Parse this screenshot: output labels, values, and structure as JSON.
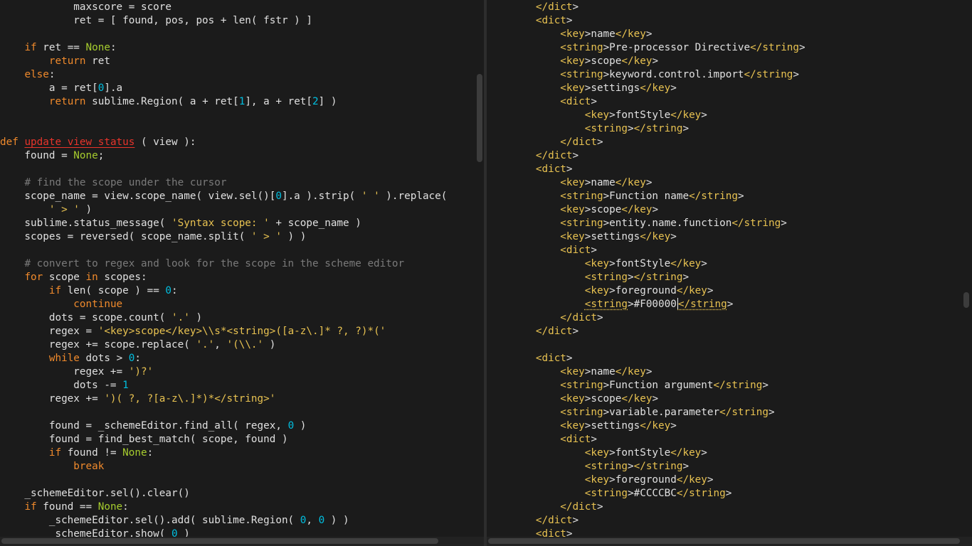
{
  "left_editor": {
    "language": "python",
    "lines": [
      [
        [
          "p",
          "            maxscore = score"
        ]
      ],
      [
        [
          "p",
          "            ret = [ found, pos, pos + "
        ],
        [
          "p",
          "len"
        ],
        [
          "p",
          "( fstr ) ]"
        ]
      ],
      [
        [
          "p",
          ""
        ]
      ],
      [
        [
          "p",
          "    "
        ],
        [
          "kw",
          "if"
        ],
        [
          "p",
          " ret == "
        ],
        [
          "const",
          "None"
        ],
        [
          "p",
          ":"
        ]
      ],
      [
        [
          "p",
          "        "
        ],
        [
          "kw",
          "return"
        ],
        [
          "p",
          " ret"
        ]
      ],
      [
        [
          "p",
          "    "
        ],
        [
          "kw",
          "else"
        ],
        [
          "p",
          ":"
        ]
      ],
      [
        [
          "p",
          "        a = ret["
        ],
        [
          "num",
          "0"
        ],
        [
          "p",
          "].a"
        ]
      ],
      [
        [
          "p",
          "        "
        ],
        [
          "kw",
          "return"
        ],
        [
          "p",
          " sublime.Region( a + ret["
        ],
        [
          "num",
          "1"
        ],
        [
          "p",
          "], a + ret["
        ],
        [
          "num",
          "2"
        ],
        [
          "p",
          "] )"
        ]
      ],
      [
        [
          "p",
          ""
        ]
      ],
      [
        [
          "p",
          ""
        ]
      ],
      [
        [
          "kw",
          "def"
        ],
        [
          "p",
          " "
        ],
        [
          "fn",
          "update_view_status"
        ],
        [
          "p",
          " ( view ):"
        ]
      ],
      [
        [
          "p",
          "    found = "
        ],
        [
          "const",
          "None"
        ],
        [
          "p",
          ";"
        ]
      ],
      [
        [
          "p",
          ""
        ]
      ],
      [
        [
          "p",
          "    "
        ],
        [
          "com",
          "# find the scope under the cursor"
        ]
      ],
      [
        [
          "p",
          "    scope_name = view.scope_name( view.sel()["
        ],
        [
          "num",
          "0"
        ],
        [
          "p",
          "].a ).strip( "
        ],
        [
          "str",
          "' '"
        ],
        [
          "p",
          " ).replace("
        ]
      ],
      [
        [
          "p",
          "        "
        ],
        [
          "str",
          "' > '"
        ],
        [
          "p",
          " )"
        ]
      ],
      [
        [
          "p",
          "    sublime.status_message( "
        ],
        [
          "str",
          "'Syntax scope: '"
        ],
        [
          "p",
          " + scope_name )"
        ]
      ],
      [
        [
          "p",
          "    scopes = reversed( scope_name.split( "
        ],
        [
          "str",
          "' > '"
        ],
        [
          "p",
          " ) )"
        ]
      ],
      [
        [
          "p",
          ""
        ]
      ],
      [
        [
          "p",
          "    "
        ],
        [
          "com",
          "# convert to regex and look for the scope in the scheme editor"
        ]
      ],
      [
        [
          "p",
          "    "
        ],
        [
          "kw",
          "for"
        ],
        [
          "p",
          " scope "
        ],
        [
          "kw",
          "in"
        ],
        [
          "p",
          " scopes:"
        ]
      ],
      [
        [
          "p",
          "        "
        ],
        [
          "kw",
          "if"
        ],
        [
          "p",
          " len( scope ) == "
        ],
        [
          "num",
          "0"
        ],
        [
          "p",
          ":"
        ]
      ],
      [
        [
          "p",
          "            "
        ],
        [
          "kw",
          "continue"
        ]
      ],
      [
        [
          "p",
          "        dots = scope.count( "
        ],
        [
          "str",
          "'.'"
        ],
        [
          "p",
          " )"
        ]
      ],
      [
        [
          "p",
          "        regex = "
        ],
        [
          "str",
          "'<key>scope</key>\\\\s*<string>([a-z\\.]* ?, ?)*('"
        ]
      ],
      [
        [
          "p",
          "        regex += scope.replace( "
        ],
        [
          "str",
          "'.'"
        ],
        [
          "p",
          ", "
        ],
        [
          "str",
          "'(\\\\.'"
        ],
        [
          "p",
          " )"
        ]
      ],
      [
        [
          "p",
          "        "
        ],
        [
          "kw",
          "while"
        ],
        [
          "p",
          " dots > "
        ],
        [
          "num",
          "0"
        ],
        [
          "p",
          ":"
        ]
      ],
      [
        [
          "p",
          "            regex += "
        ],
        [
          "str",
          "')?'"
        ]
      ],
      [
        [
          "p",
          "            dots -= "
        ],
        [
          "num",
          "1"
        ]
      ],
      [
        [
          "p",
          "        regex += "
        ],
        [
          "str",
          "')( ?, ?[a-z\\.]*)*</string>'"
        ]
      ],
      [
        [
          "p",
          ""
        ]
      ],
      [
        [
          "p",
          "        found = _schemeEditor.find_all( regex, "
        ],
        [
          "num",
          "0"
        ],
        [
          "p",
          " )"
        ]
      ],
      [
        [
          "p",
          "        found = find_best_match( scope, found )"
        ]
      ],
      [
        [
          "p",
          "        "
        ],
        [
          "kw",
          "if"
        ],
        [
          "p",
          " found != "
        ],
        [
          "const",
          "None"
        ],
        [
          "p",
          ":"
        ]
      ],
      [
        [
          "p",
          "            "
        ],
        [
          "kw",
          "break"
        ]
      ],
      [
        [
          "p",
          ""
        ]
      ],
      [
        [
          "p",
          "    _schemeEditor.sel().clear()"
        ]
      ],
      [
        [
          "p",
          "    "
        ],
        [
          "kw",
          "if"
        ],
        [
          "p",
          " found == "
        ],
        [
          "const",
          "None"
        ],
        [
          "p",
          ":"
        ]
      ],
      [
        [
          "p",
          "        _schemeEditor.sel().add( sublime.Region( "
        ],
        [
          "num",
          "0"
        ],
        [
          "p",
          ", "
        ],
        [
          "num",
          "0"
        ],
        [
          "p",
          " ) )"
        ]
      ],
      [
        [
          "p",
          "        _schemeEditor.show( "
        ],
        [
          "num",
          "0"
        ],
        [
          "p",
          " )"
        ]
      ]
    ]
  },
  "right_editor": {
    "language": "xml",
    "lines": [
      [
        [
          "p",
          "        "
        ],
        [
          "tag",
          "</dict"
        ],
        [
          "p",
          ">"
        ]
      ],
      [
        [
          "p",
          "        "
        ],
        [
          "tag",
          "<dict"
        ],
        [
          "p",
          ">"
        ]
      ],
      [
        [
          "p",
          "            "
        ],
        [
          "tag",
          "<key"
        ],
        [
          "p",
          ">name"
        ],
        [
          "tag",
          "</key"
        ],
        [
          "p",
          ">"
        ]
      ],
      [
        [
          "p",
          "            "
        ],
        [
          "tag",
          "<string"
        ],
        [
          "p",
          ">Pre-processor Directive"
        ],
        [
          "tag",
          "</string"
        ],
        [
          "p",
          ">"
        ]
      ],
      [
        [
          "p",
          "            "
        ],
        [
          "tag",
          "<key"
        ],
        [
          "p",
          ">scope"
        ],
        [
          "tag",
          "</key"
        ],
        [
          "p",
          ">"
        ]
      ],
      [
        [
          "p",
          "            "
        ],
        [
          "tag",
          "<string"
        ],
        [
          "p",
          ">keyword.control.import"
        ],
        [
          "tag",
          "</string"
        ],
        [
          "p",
          ">"
        ]
      ],
      [
        [
          "p",
          "            "
        ],
        [
          "tag",
          "<key"
        ],
        [
          "p",
          ">settings"
        ],
        [
          "tag",
          "</key"
        ],
        [
          "p",
          ">"
        ]
      ],
      [
        [
          "p",
          "            "
        ],
        [
          "tag",
          "<dict"
        ],
        [
          "p",
          ">"
        ]
      ],
      [
        [
          "p",
          "                "
        ],
        [
          "tag",
          "<key"
        ],
        [
          "p",
          ">fontStyle"
        ],
        [
          "tag",
          "</key"
        ],
        [
          "p",
          ">"
        ]
      ],
      [
        [
          "p",
          "                "
        ],
        [
          "tag",
          "<string"
        ],
        [
          "p",
          ">"
        ],
        [
          "tag",
          "</string"
        ],
        [
          "p",
          ">"
        ]
      ],
      [
        [
          "p",
          "            "
        ],
        [
          "tag",
          "</dict"
        ],
        [
          "p",
          ">"
        ]
      ],
      [
        [
          "p",
          "        "
        ],
        [
          "tag",
          "</dict"
        ],
        [
          "p",
          ">"
        ]
      ],
      [
        [
          "p",
          "        "
        ],
        [
          "tag",
          "<dict"
        ],
        [
          "p",
          ">"
        ]
      ],
      [
        [
          "p",
          "            "
        ],
        [
          "tag",
          "<key"
        ],
        [
          "p",
          ">name"
        ],
        [
          "tag",
          "</key"
        ],
        [
          "p",
          ">"
        ]
      ],
      [
        [
          "p",
          "            "
        ],
        [
          "tag",
          "<string"
        ],
        [
          "p",
          ">Function name"
        ],
        [
          "tag",
          "</string"
        ],
        [
          "p",
          ">"
        ]
      ],
      [
        [
          "p",
          "            "
        ],
        [
          "tag",
          "<key"
        ],
        [
          "p",
          ">scope"
        ],
        [
          "tag",
          "</key"
        ],
        [
          "p",
          ">"
        ]
      ],
      [
        [
          "p",
          "            "
        ],
        [
          "tag",
          "<string"
        ],
        [
          "p",
          ">entity.name.function"
        ],
        [
          "tag",
          "</string"
        ],
        [
          "p",
          ">"
        ]
      ],
      [
        [
          "p",
          "            "
        ],
        [
          "tag",
          "<key"
        ],
        [
          "p",
          ">settings"
        ],
        [
          "tag",
          "</key"
        ],
        [
          "p",
          ">"
        ]
      ],
      [
        [
          "p",
          "            "
        ],
        [
          "tag",
          "<dict"
        ],
        [
          "p",
          ">"
        ]
      ],
      [
        [
          "p",
          "                "
        ],
        [
          "tag",
          "<key"
        ],
        [
          "p",
          ">fontStyle"
        ],
        [
          "tag",
          "</key"
        ],
        [
          "p",
          ">"
        ]
      ],
      [
        [
          "p",
          "                "
        ],
        [
          "tag",
          "<string"
        ],
        [
          "p",
          ">"
        ],
        [
          "tag",
          "</string"
        ],
        [
          "p",
          ">"
        ]
      ],
      [
        [
          "p",
          "                "
        ],
        [
          "tag",
          "<key"
        ],
        [
          "p",
          ">foreground"
        ],
        [
          "tag",
          "</key"
        ],
        [
          "p",
          ">"
        ]
      ],
      [
        [
          "p",
          "                "
        ],
        [
          "tagu",
          "<string"
        ],
        [
          "p",
          ">#F00000"
        ],
        [
          "caret",
          ""
        ],
        [
          "tagu",
          "</string"
        ],
        [
          "p",
          ">"
        ]
      ],
      [
        [
          "p",
          "            "
        ],
        [
          "tag",
          "</dict"
        ],
        [
          "p",
          ">"
        ]
      ],
      [
        [
          "p",
          "        "
        ],
        [
          "tag",
          "</dict"
        ],
        [
          "p",
          ">"
        ]
      ],
      [
        [
          "p",
          ""
        ]
      ],
      [
        [
          "p",
          "        "
        ],
        [
          "tag",
          "<dict"
        ],
        [
          "p",
          ">"
        ]
      ],
      [
        [
          "p",
          "            "
        ],
        [
          "tag",
          "<key"
        ],
        [
          "p",
          ">name"
        ],
        [
          "tag",
          "</key"
        ],
        [
          "p",
          ">"
        ]
      ],
      [
        [
          "p",
          "            "
        ],
        [
          "tag",
          "<string"
        ],
        [
          "p",
          ">Function argument"
        ],
        [
          "tag",
          "</string"
        ],
        [
          "p",
          ">"
        ]
      ],
      [
        [
          "p",
          "            "
        ],
        [
          "tag",
          "<key"
        ],
        [
          "p",
          ">scope"
        ],
        [
          "tag",
          "</key"
        ],
        [
          "p",
          ">"
        ]
      ],
      [
        [
          "p",
          "            "
        ],
        [
          "tag",
          "<string"
        ],
        [
          "p",
          ">variable.parameter"
        ],
        [
          "tag",
          "</string"
        ],
        [
          "p",
          ">"
        ]
      ],
      [
        [
          "p",
          "            "
        ],
        [
          "tag",
          "<key"
        ],
        [
          "p",
          ">settings"
        ],
        [
          "tag",
          "</key"
        ],
        [
          "p",
          ">"
        ]
      ],
      [
        [
          "p",
          "            "
        ],
        [
          "tag",
          "<dict"
        ],
        [
          "p",
          ">"
        ]
      ],
      [
        [
          "p",
          "                "
        ],
        [
          "tag",
          "<key"
        ],
        [
          "p",
          ">fontStyle"
        ],
        [
          "tag",
          "</key"
        ],
        [
          "p",
          ">"
        ]
      ],
      [
        [
          "p",
          "                "
        ],
        [
          "tag",
          "<string"
        ],
        [
          "p",
          ">"
        ],
        [
          "tag",
          "</string"
        ],
        [
          "p",
          ">"
        ]
      ],
      [
        [
          "p",
          "                "
        ],
        [
          "tag",
          "<key"
        ],
        [
          "p",
          ">foreground"
        ],
        [
          "tag",
          "</key"
        ],
        [
          "p",
          ">"
        ]
      ],
      [
        [
          "p",
          "                "
        ],
        [
          "tag",
          "<string"
        ],
        [
          "p",
          ">#CCCCBC"
        ],
        [
          "tag",
          "</string"
        ],
        [
          "p",
          ">"
        ]
      ],
      [
        [
          "p",
          "            "
        ],
        [
          "tag",
          "</dict"
        ],
        [
          "p",
          ">"
        ]
      ],
      [
        [
          "p",
          "        "
        ],
        [
          "tag",
          "</dict"
        ],
        [
          "p",
          ">"
        ]
      ],
      [
        [
          "p",
          "        "
        ],
        [
          "tag",
          "<dict"
        ],
        [
          "p",
          ">"
        ]
      ]
    ]
  },
  "theme": {
    "background": "#1b1b1b",
    "text": "#e0e0e0",
    "keyword": "#f08a2c",
    "function_name": "#e8342b",
    "string": "#e8c251",
    "number": "#00bfe0",
    "constant": "#a6cc2e",
    "comment": "#7a7a7a"
  }
}
